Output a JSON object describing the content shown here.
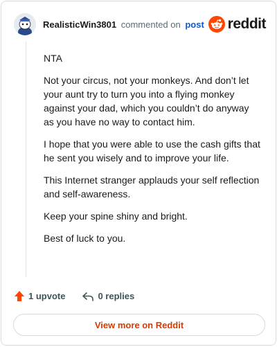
{
  "header": {
    "username": "RealisticWin3801",
    "action": "commented on",
    "post_link": "post",
    "brand": "reddit"
  },
  "comment": {
    "paragraphs": [
      "NTA",
      "Not your circus, not your monkeys. And don’t let your aunt try to turn you into a flying monkey against your dad, which you couldn’t do anyway as you have no way to contact him.",
      "I hope that you were able to use the cash gifts that he sent you wisely and to improve your life.",
      "This Internet stranger applauds your self reflection and self-awareness.",
      "Keep your spine shiny and bright.",
      "Best of luck to you."
    ]
  },
  "footer": {
    "upvotes": "1 upvote",
    "replies": "0 replies"
  },
  "cta": {
    "view_more": "View more on Reddit"
  },
  "colors": {
    "accent": "#ff4500",
    "link": "#0a5ad1",
    "cta_text": "#d93a00"
  }
}
